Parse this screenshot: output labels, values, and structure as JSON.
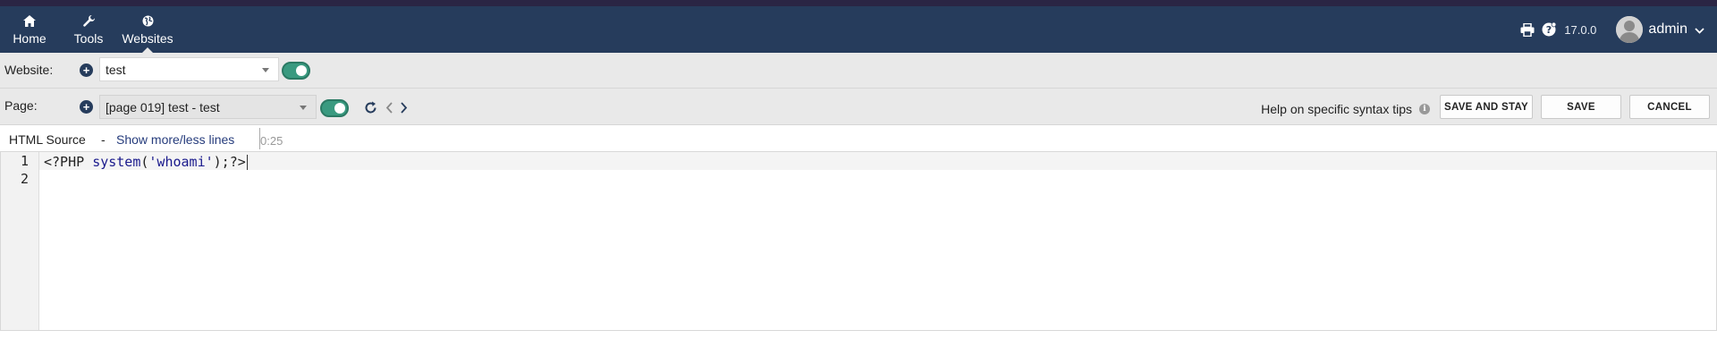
{
  "colors": {
    "navbar": "#263c5c",
    "toolbar_bg": "#e9e9e9",
    "toggle_on": "#3a9a80",
    "link": "#263c7c"
  },
  "nav": {
    "items": [
      {
        "label": "Home",
        "icon": "home-icon"
      },
      {
        "label": "Tools",
        "icon": "wrench-icon"
      },
      {
        "label": "Websites",
        "icon": "globe-icon"
      }
    ],
    "version": "17.0.0",
    "user": "admin"
  },
  "website_bar": {
    "label": "Website:",
    "selected": "test",
    "enabled": true
  },
  "page_bar": {
    "label": "Page:",
    "selected": "[page 019] test - test",
    "enabled": true,
    "help_text": "Help on specific syntax tips",
    "buttons": {
      "save_and_stay": "SAVE AND STAY",
      "save": "SAVE",
      "cancel": "CANCEL"
    }
  },
  "source": {
    "title": "HTML Source",
    "separator": "-",
    "toggle_link": "Show more/less lines",
    "timer": "0:25"
  },
  "editor": {
    "line_numbers": [
      "1",
      "2"
    ],
    "lines": [
      {
        "tokens": [
          "<?PHP ",
          "system",
          "(",
          "'whoami'",
          ");?>"
        ]
      },
      {
        "tokens": []
      }
    ]
  }
}
